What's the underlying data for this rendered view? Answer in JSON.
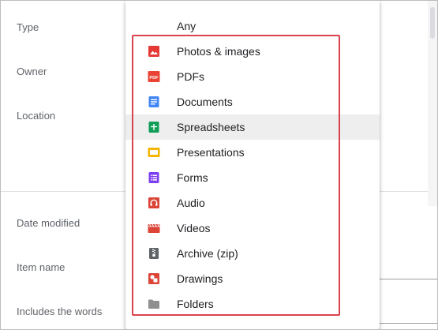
{
  "filters": {
    "type_label": "Type",
    "owner_label": "Owner",
    "location_label": "Location",
    "date_modified_label": "Date modified",
    "item_name_label": "Item name",
    "includes_words_label": "Includes the words"
  },
  "type_menu": {
    "items": [
      {
        "label": "Any",
        "icon": "none",
        "color": ""
      },
      {
        "label": "Photos & images",
        "icon": "image-icon",
        "color": "#e53935"
      },
      {
        "label": "PDFs",
        "icon": "pdf-icon",
        "color": "#ea4335",
        "icon_text": "PDF"
      },
      {
        "label": "Documents",
        "icon": "document-icon",
        "color": "#4285f4"
      },
      {
        "label": "Spreadsheets",
        "icon": "spreadsheet-icon",
        "color": "#0f9d58"
      },
      {
        "label": "Presentations",
        "icon": "presentation-icon",
        "color": "#f4b400"
      },
      {
        "label": "Forms",
        "icon": "forms-icon",
        "color": "#7e3ff2"
      },
      {
        "label": "Audio",
        "icon": "audio-icon",
        "color": "#db4437"
      },
      {
        "label": "Videos",
        "icon": "video-icon",
        "color": "#db4437"
      },
      {
        "label": "Archive (zip)",
        "icon": "archive-icon",
        "color": "#5f6368"
      },
      {
        "label": "Drawings",
        "icon": "drawing-icon",
        "color": "#db4437"
      },
      {
        "label": "Folders",
        "icon": "folder-icon",
        "color": "#8f8f8f"
      }
    ],
    "hovered_item": "Spreadsheets",
    "highlight_color": "#d9434b"
  }
}
